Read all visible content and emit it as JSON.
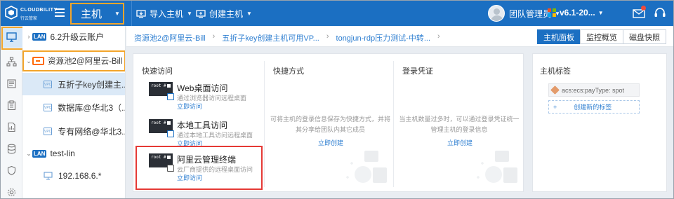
{
  "topbar": {
    "brand": "CLOUDBILITY",
    "brand_sub": "行云管家",
    "mode": "主机",
    "import_host": "导入主机",
    "create_host": "创建主机",
    "user_name": "团队管理员",
    "version": "v6.1-20..."
  },
  "tree": {
    "items": [
      {
        "label": "6.2升级云账户",
        "badge": "LAN"
      },
      {
        "label": "资源池2@阿里云-Bill"
      },
      {
        "label": "五折子key创建主..."
      },
      {
        "label": "数据库@华北3（..."
      },
      {
        "label": "专有网络@华北3..."
      },
      {
        "label": "test-lin",
        "badge": "LAN"
      },
      {
        "label": "192.168.6.*"
      }
    ],
    "vpc_icon_text": "VPC"
  },
  "breadcrumb": [
    "资源池2@阿里云-Bill",
    "五折子key创建主机可用VP...",
    "tongjun-rdp压力测试-中转..."
  ],
  "tabs": [
    "主机面板",
    "监控概览",
    "磁盘快照"
  ],
  "quick_access": {
    "title": "快速访问",
    "term_text": "root #",
    "items": [
      {
        "title": "Web桌面访问",
        "desc": "通过浏览器访问远程桌面",
        "link": "立即访问"
      },
      {
        "title": "本地工具访问",
        "desc": "通过本地工具访问远程桌面",
        "link": "立即访问"
      },
      {
        "title": "阿里云管理终端",
        "desc": "云厂商提供的远程桌面访问",
        "link": "立即访问"
      }
    ]
  },
  "shortcuts": {
    "title": "快捷方式",
    "empty_text": [
      "可将主机的登录信息保存为快捷方式，并将",
      "其分享给团队内其它成员"
    ],
    "link": "立即创建"
  },
  "credentials": {
    "title": "登录凭证",
    "empty_text": [
      "当主机数量过多时，可以通过登录凭证统一",
      "管理主机的登录信息"
    ],
    "link": "立即创建"
  },
  "tags": {
    "title": "主机标签",
    "chip": "acs:ecs:payType: spot",
    "create": "创建新的标签"
  },
  "colors": {
    "primary": "#1b6fc2",
    "highlight_orange": "#f3a52b",
    "highlight_red": "#e53935",
    "aliyun_orange": "#ff6a00"
  }
}
